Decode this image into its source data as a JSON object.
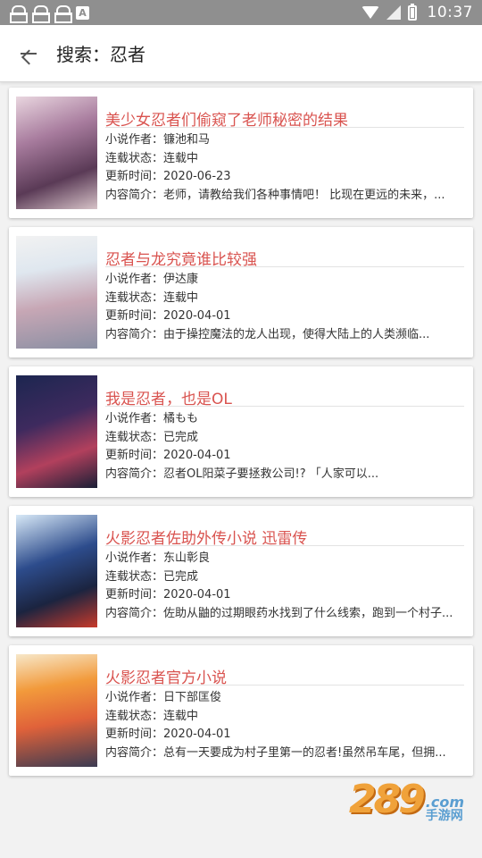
{
  "status_bar": {
    "time": "10:37",
    "a_badge": "A",
    "icons": [
      "notification-icon",
      "notification-icon",
      "notification-icon",
      "a-icon",
      "wifi-icon",
      "signal-icon",
      "battery-icon"
    ]
  },
  "app_bar": {
    "title": "搜索：忍者",
    "back_icon": "arrow-left-icon"
  },
  "labels": {
    "author": "小说作者：",
    "status": "连载状态：",
    "updated": "更新时间：",
    "summary": "内容简介："
  },
  "results": [
    {
      "title": "美少女忍者们偷窥了老师秘密的结果",
      "author": "镰池和马",
      "status": "连载中",
      "updated": "2020-06-23",
      "summary": "老师，请教给我们各种事情吧！ 比现在更远的未来，..."
    },
    {
      "title": "忍者与龙究竟谁比较强",
      "author": "伊达康",
      "status": "连载中",
      "updated": "2020-04-01",
      "summary": "由于操控魔法的龙人出现，使得大陆上的人类濒临..."
    },
    {
      "title": "我是忍者，也是OL",
      "author": "橘もも",
      "status": "已完成",
      "updated": "2020-04-01",
      "summary": "忍者OL阳菜子要拯救公司!? 「人家可以..."
    },
    {
      "title": "火影忍者佐助外传小说 迅雷传",
      "author": "东山彰良",
      "status": "已完成",
      "updated": "2020-04-01",
      "summary": "佐助从鼬的过期眼药水找到了什么线索，跑到一个村子..."
    },
    {
      "title": "火影忍者官方小说",
      "author": "日下部匡俊",
      "status": "连载中",
      "updated": "2020-04-01",
      "summary": "总有一天要成为村子里第一的忍者!虽然吊车尾，但拥..."
    }
  ],
  "watermark": {
    "number": "289",
    "domain": ".com",
    "text": "手游网"
  }
}
